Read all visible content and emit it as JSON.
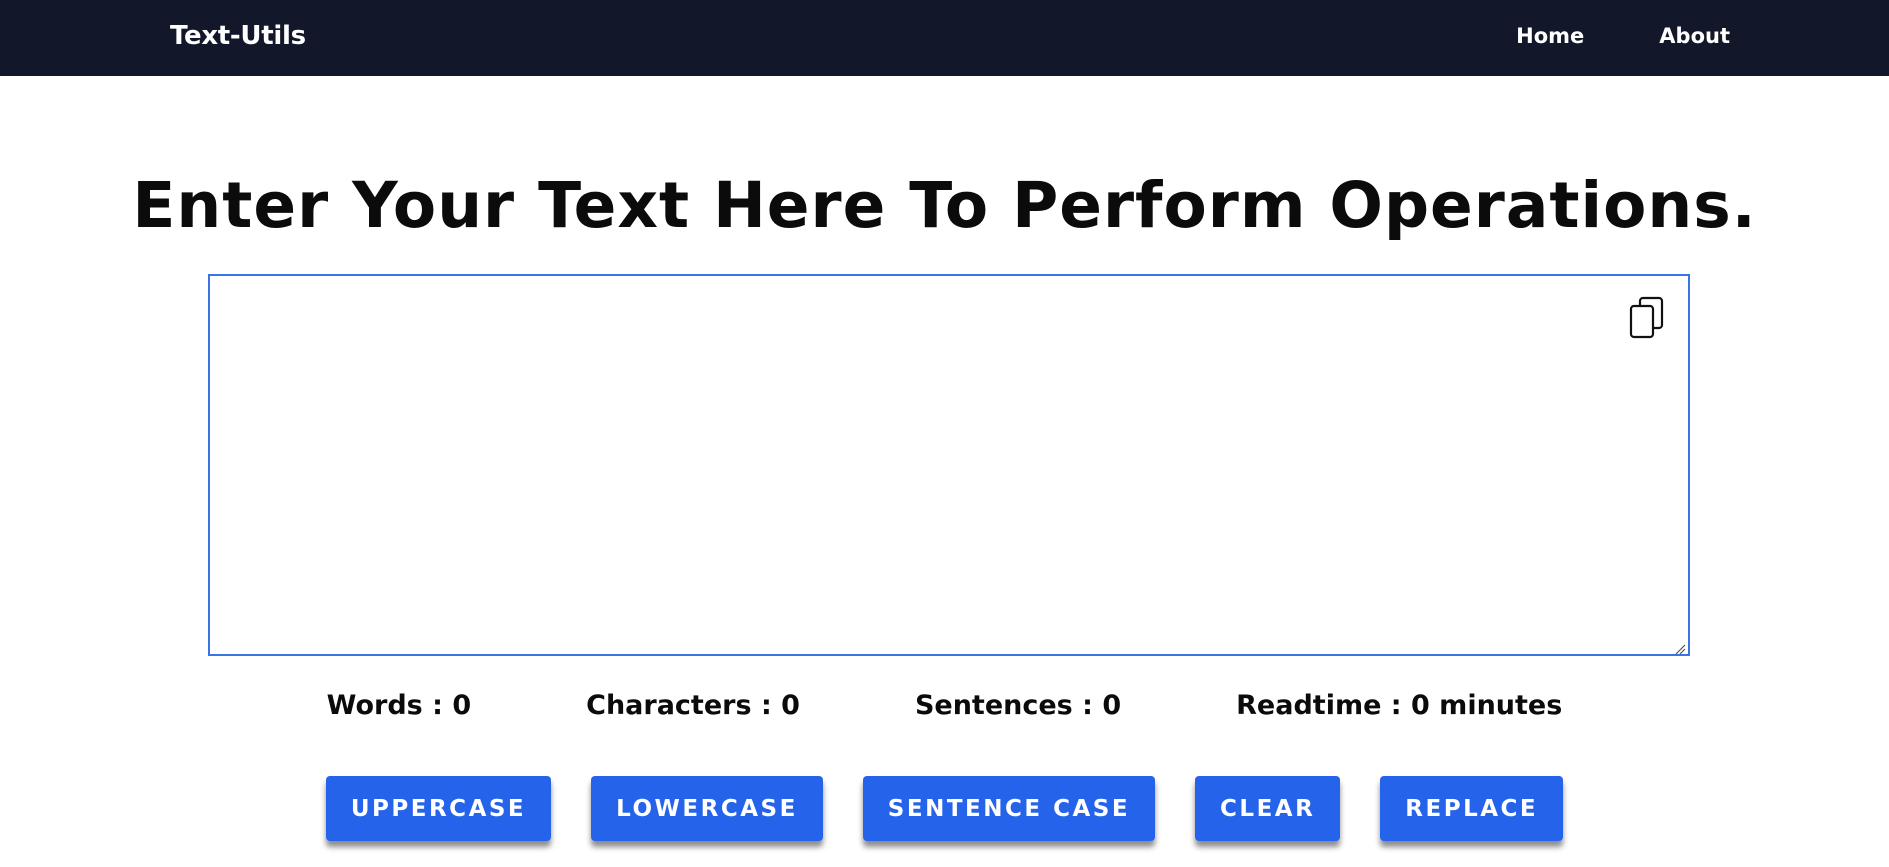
{
  "navbar": {
    "brand": "Text-Utils",
    "links": [
      "Home",
      "About"
    ]
  },
  "main": {
    "heading": "Enter Your Text Here To Perform Operations.",
    "textarea": {
      "value": "",
      "placeholder": ""
    },
    "copy_icon": "copy-icon"
  },
  "stats": {
    "words": "Words : 0",
    "characters": "Characters : 0",
    "sentences": "Sentences : 0",
    "readtime": "Readtime : 0 minutes"
  },
  "actions": {
    "uppercase": "UPPERCASE",
    "lowercase": "LOWERCASE",
    "sentence_case": "SENTENCE CASE",
    "clear": "CLEAR",
    "replace": "REPLACE"
  },
  "colors": {
    "navbar_bg": "#121829",
    "accent": "#2563eb",
    "textarea_border": "#3b74e6"
  }
}
